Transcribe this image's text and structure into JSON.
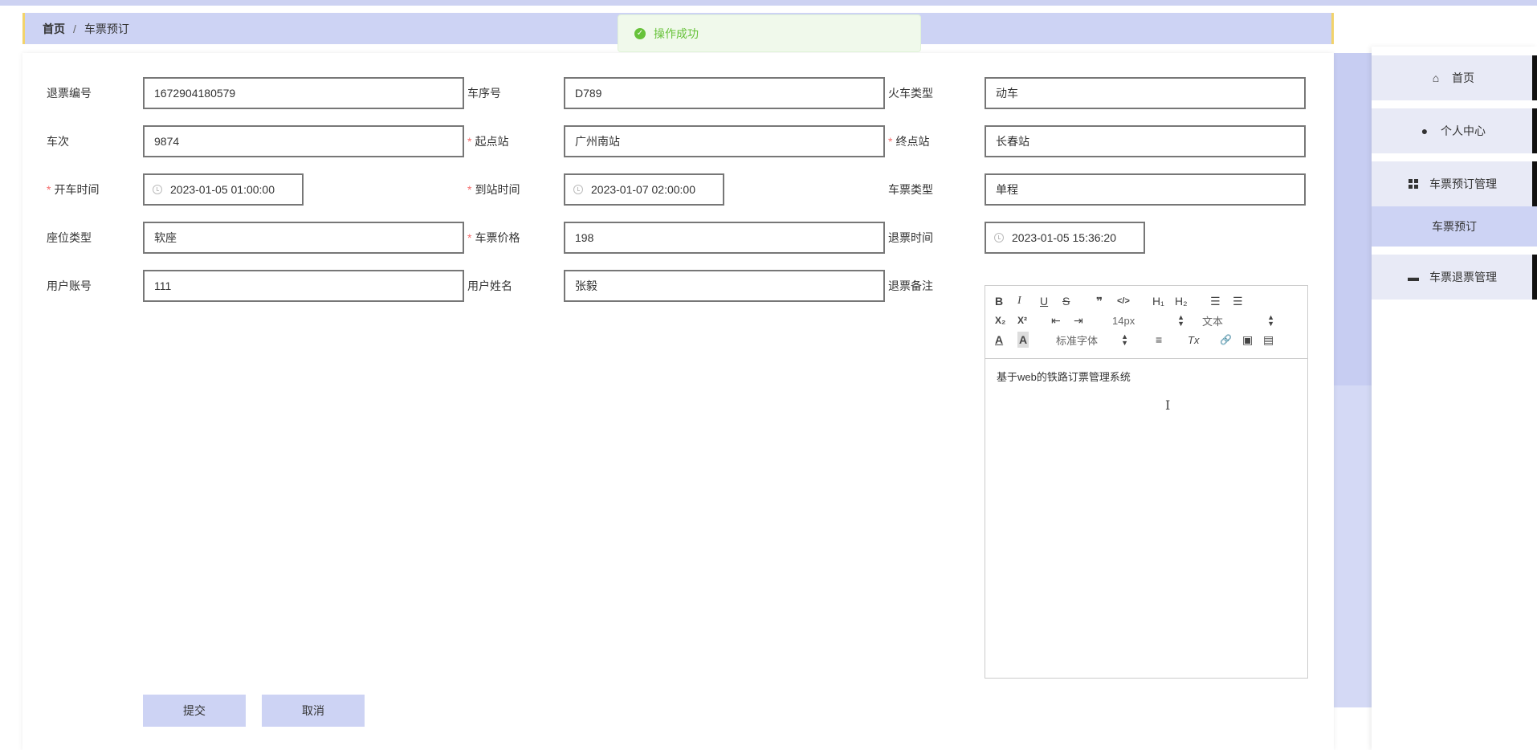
{
  "breadcrumb": {
    "home": "首页",
    "separator": "/",
    "current": "车票预订"
  },
  "toast": {
    "message": "操作成功",
    "color": "#67c23a"
  },
  "form": {
    "refund_no": {
      "label": "退票编号",
      "value": "1672904180579"
    },
    "car_no": {
      "label": "车序号",
      "value": "D789"
    },
    "train_type": {
      "label": "火车类型",
      "value": "动车"
    },
    "train_no": {
      "label": "车次",
      "value": "9874"
    },
    "start_station": {
      "label": "起点站",
      "value": "广州南站",
      "required": true
    },
    "end_station": {
      "label": "终点站",
      "value": "长春站",
      "required": true
    },
    "depart_time": {
      "label": "开车时间",
      "value": "2023-01-05 01:00:00",
      "required": true
    },
    "arrive_time": {
      "label": "到站时间",
      "value": "2023-01-07 02:00:00",
      "required": true
    },
    "ticket_type": {
      "label": "车票类型",
      "value": "单程"
    },
    "seat_type": {
      "label": "座位类型",
      "value": "软座"
    },
    "price": {
      "label": "车票价格",
      "value": "198",
      "required": true
    },
    "refund_time": {
      "label": "退票时间",
      "value": "2023-01-05 15:36:20"
    },
    "account": {
      "label": "用户账号",
      "value": "111"
    },
    "user_name": {
      "label": "用户姓名",
      "value": "张毅"
    },
    "refund_note": {
      "label": "退票备注"
    },
    "required_mark": "*"
  },
  "editor": {
    "toolbar": {
      "bold": "B",
      "italic": "I",
      "underline": "U",
      "strike": "S",
      "quote": "❞",
      "code": "</>",
      "h1": "H₁",
      "h2": "H₂",
      "ordered_list": "☰",
      "bullet_list": "☰",
      "subscript": "X₂",
      "superscript": "X²",
      "outdent": "⇤",
      "indent": "⇥",
      "size_value": "14px",
      "header_value": "文本",
      "color": "A",
      "background": "A",
      "font_value": "标准字体",
      "align": "≡",
      "clean": "Tx",
      "link": "🔗",
      "image": "▣",
      "video": "▤"
    },
    "content": "基于web的铁路订票管理系统"
  },
  "buttons": {
    "submit": "提交",
    "cancel": "取消"
  },
  "sidebar": {
    "items": [
      {
        "label": "首页",
        "icon": "home-icon"
      },
      {
        "label": "个人中心",
        "icon": "user-icon"
      },
      {
        "label": "车票预订管理",
        "icon": "grid-icon"
      },
      {
        "label": "车票退票管理",
        "icon": "monitor-icon"
      }
    ],
    "submenu": [
      {
        "label": "车票预订"
      }
    ]
  },
  "colors": {
    "accent": "#cdd3f4",
    "border_yellow": "#f2d36b",
    "required": "#f56c6c"
  }
}
